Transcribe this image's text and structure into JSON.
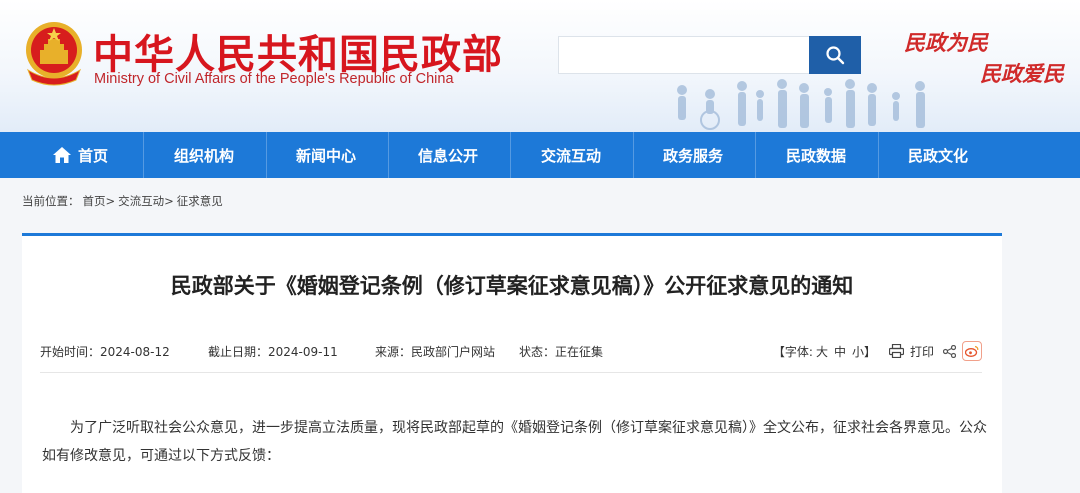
{
  "header": {
    "site_title_cn": "中华人民共和国民政部",
    "site_title_en": "Ministry of Civil Affairs of the People's Republic of China",
    "search_value": "",
    "slogan_line1": "民政为民",
    "slogan_line2": "民政爱民",
    "emblem_icon": "national-emblem-icon",
    "search_icon": "search-icon"
  },
  "nav": {
    "items": [
      {
        "label": "首页",
        "icon": "home-icon"
      },
      {
        "label": "组织机构"
      },
      {
        "label": "新闻中心"
      },
      {
        "label": "信息公开"
      },
      {
        "label": "交流互动"
      },
      {
        "label": "政务服务"
      },
      {
        "label": "民政数据"
      },
      {
        "label": "民政文化"
      }
    ]
  },
  "breadcrumb": {
    "prefix": "当前位置：",
    "items": [
      "首页>",
      "交流互动>",
      "征求意见"
    ]
  },
  "article": {
    "title": "民政部关于《婚姻登记条例（修订草案征求意见稿）》公开征求意见的通知",
    "meta": {
      "start": "开始时间：2024-08-12",
      "end": "截止日期：2024-09-11",
      "source": "来源：民政部门户网站",
      "status": "状态：正在征集"
    },
    "tools": {
      "font_prefix": "【字体:",
      "large": "大",
      "medium": "中",
      "small": "小】",
      "print": "打印"
    },
    "body": "为了广泛听取社会公众意见，进一步提高立法质量，现将民政部起草的《婚姻登记条例（修订草案征求意见稿）》全文公布，征求社会各界意见。公众如有修改意见，可通过以下方式反馈："
  },
  "colors": {
    "brand_red": "#d7161e",
    "nav_blue": "#1d79d8",
    "search_blue": "#1f5fa8"
  }
}
